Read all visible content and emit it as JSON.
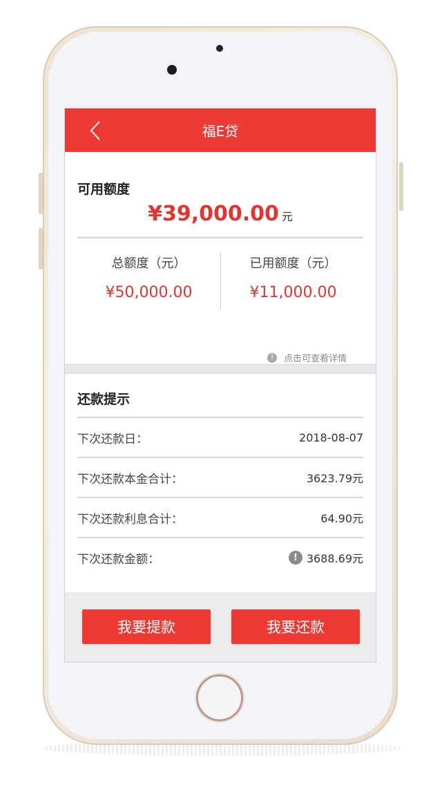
{
  "header": {
    "title": "福E贷"
  },
  "credit": {
    "available_label": "可用额度",
    "available_amount": "¥39,000.00",
    "available_unit": "元",
    "total_label": "总额度（元）",
    "total_value": "¥50,000.00",
    "used_label": "已用额度（元）",
    "used_value": "¥11,000.00",
    "detail_hint": "点击可查看详情"
  },
  "repayment": {
    "title": "还款提示",
    "rows": [
      {
        "label": "下次还款日：",
        "value": "2018-08-07"
      },
      {
        "label": "下次还款本金合计：",
        "value": "3623.79元"
      },
      {
        "label": "下次还款利息合计：",
        "value": "64.90元"
      },
      {
        "label": "下次还款金额：",
        "value": "3688.69元"
      }
    ]
  },
  "footer": {
    "withdraw_label": "我要提款",
    "repay_label": "我要还款"
  },
  "colors": {
    "accent": "#ee3934",
    "amount_red": "#e03530"
  },
  "icons": {
    "back": "chevron-left-icon",
    "info": "info-icon",
    "warning": "exclamation-circle-icon"
  }
}
